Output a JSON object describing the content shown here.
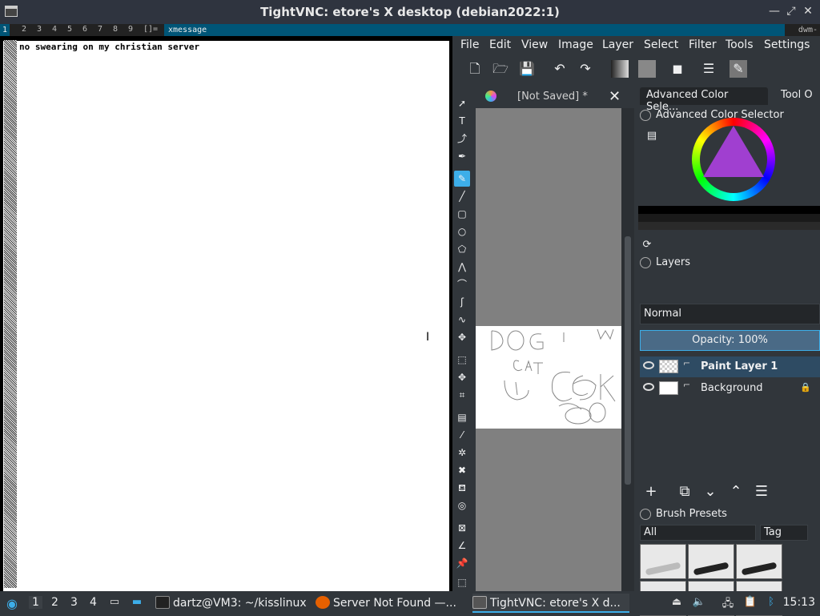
{
  "window": {
    "title": "TightVNC: etore's X desktop (debian2022:1)",
    "controls": [
      "—",
      "⤢",
      "✕"
    ]
  },
  "dwm": {
    "tags": [
      "1",
      "2",
      "3",
      "4",
      "5",
      "6",
      "7",
      "8",
      "9"
    ],
    "layout": "[]=",
    "window_title": "xmessage",
    "status": "dwm-"
  },
  "xmessage": {
    "text": "no swearing on my christian server"
  },
  "krita": {
    "menu": [
      "File",
      "Edit",
      "View",
      "Image",
      "Layer",
      "Select",
      "Filter",
      "Tools",
      "Settings"
    ],
    "document_tab": "[Not Saved]  *",
    "docker_tabs": [
      "Advanced Color Sele...",
      "Tool O"
    ],
    "color_selector_title": "Advanced Color Selector",
    "layers_title": "Layers",
    "blend_mode": "Normal",
    "opacity_label": "Opacity:  100%",
    "layers": [
      {
        "name": "Paint Layer 1",
        "selected": true
      },
      {
        "name": "Background",
        "selected": false
      }
    ],
    "brush_presets_title": "Brush Presets",
    "brush_filter": "All",
    "tag_label": "Tag"
  },
  "taskbar": {
    "workspaces": [
      "1",
      "2",
      "3",
      "4"
    ],
    "tasks": [
      {
        "label": "dartz@VM3: ~/kisslinux",
        "icon": "terminal-icon"
      },
      {
        "label": "Server Not Found —...",
        "icon": "firefox-icon"
      },
      {
        "label": "TightVNC: etore's X d...",
        "icon": "vnc-icon"
      }
    ],
    "clock": "15:13"
  }
}
